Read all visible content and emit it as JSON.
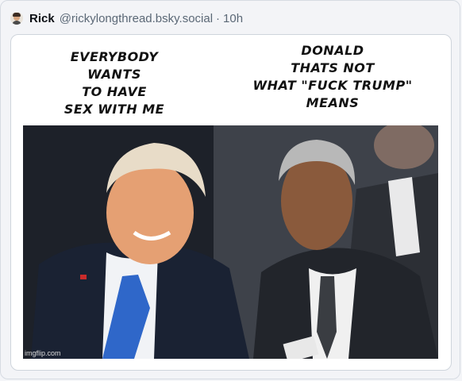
{
  "post": {
    "display_name": "Rick",
    "handle": "@rickylongthread.bsky.social",
    "separator": "·",
    "time": "10h",
    "avatar_icon": "person-avatar-icon"
  },
  "meme": {
    "caption_left": "EVERYBODY\nWANTS\nTO HAVE\nSEX WITH ME",
    "caption_right": "DONALD\nTHATS NOT\nWHAT \"FUCK TRUMP\"\nMEANS",
    "watermark": "imgflip.com"
  }
}
